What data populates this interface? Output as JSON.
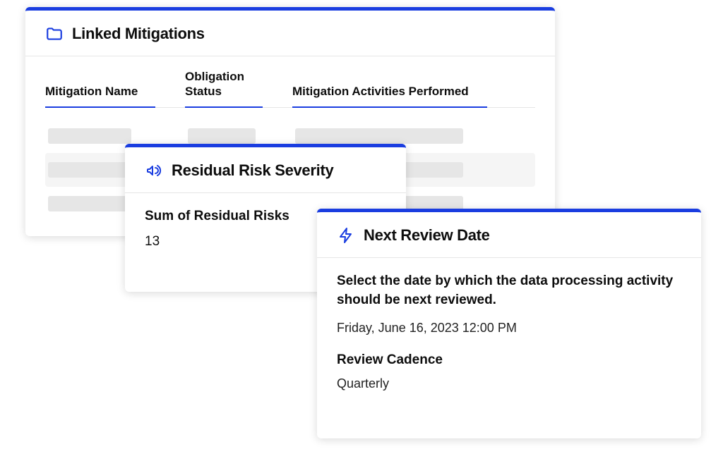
{
  "linked_mitigations": {
    "title": "Linked Mitigations",
    "columns": {
      "name": "Mitigation Name",
      "status": "Obligation Status",
      "activities": "Mitigation Activities Performed"
    }
  },
  "residual": {
    "title": "Residual Risk Severity",
    "sum_label": "Sum of Residual Risks",
    "sum_value": "13"
  },
  "review": {
    "title": "Next Review Date",
    "prompt": "Select the date by which the data processing activity should be next reviewed.",
    "date": "Friday, June 16, 2023 12:00 PM",
    "cadence_label": "Review Cadence",
    "cadence_value": "Quarterly"
  }
}
